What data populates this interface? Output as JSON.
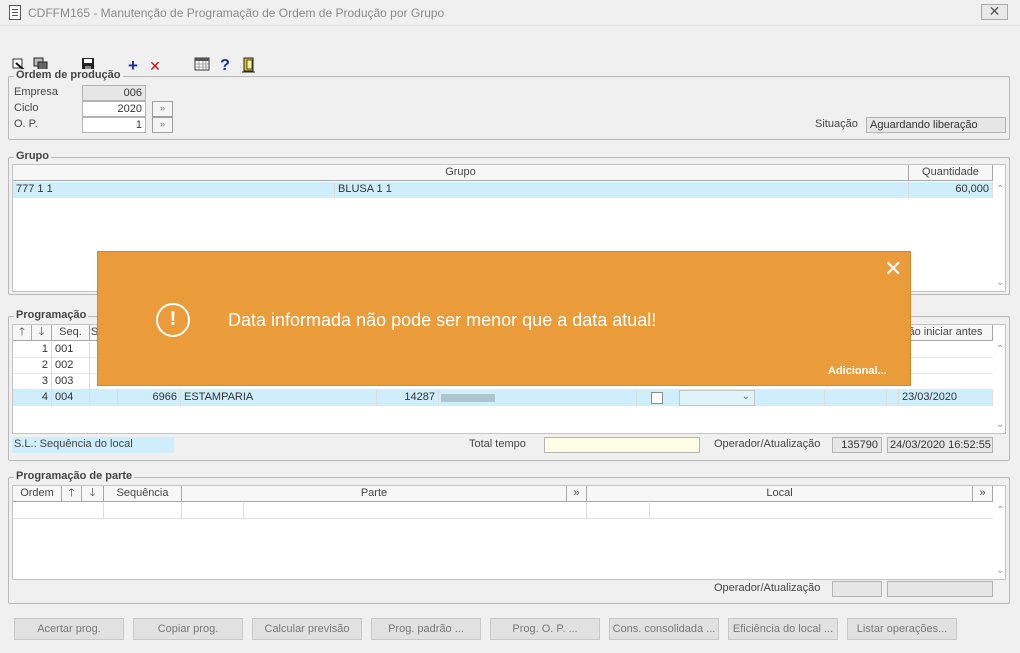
{
  "window": {
    "title": "CDFFM165 - Manutenção de Programação de Ordem de Produção por Grupo",
    "close_glyph": "✕"
  },
  "toolbar": {
    "icons": [
      "select-icon",
      "copy-icon",
      "save-icon",
      "add-icon",
      "delete-icon",
      "calendar-icon",
      "help-icon",
      "exit-icon"
    ],
    "add_glyph": "+",
    "delete_glyph": "✕",
    "help_glyph": "?"
  },
  "ordem": {
    "title": "Ordem de produção",
    "empresa_label": "Empresa",
    "empresa_value": "006",
    "ciclo_label": "Ciclo",
    "ciclo_value": "2020",
    "op_label": "O. P.",
    "op_value": "1",
    "situacao_label": "Situação",
    "situacao_value": "Aguardando liberação"
  },
  "grupo": {
    "title": "Grupo",
    "headers": {
      "grupo": "Grupo",
      "quantidade": "Quantidade"
    },
    "rows": [
      {
        "codigo": "777 1 1",
        "descricao": "BLUSA 1 1",
        "quantidade": "60,000"
      }
    ]
  },
  "programacao": {
    "title": "Programação",
    "headers": {
      "seq": "Seq.",
      "s": "S",
      "iniciar": "ão iniciar antes"
    },
    "rows": [
      {
        "n": "1",
        "seq": "001"
      },
      {
        "n": "2",
        "seq": "002"
      },
      {
        "n": "3",
        "seq": "003"
      },
      {
        "n": "4",
        "seq": "004",
        "local": "6966",
        "nome": "ESTAMPARIA",
        "cod": "14287",
        "data": "23/03/2020"
      }
    ],
    "sl_label": "S.L.: Sequência do local",
    "total_label": "Total tempo",
    "total_value": "",
    "operador_label": "Operador/Atualização",
    "operador_value": "135790",
    "atualizacao_value": "24/03/2020 16:52:55"
  },
  "parte": {
    "title": "Programação de parte",
    "headers": {
      "ordem": "Ordem",
      "sequencia": "Sequência",
      "parte": "Parte",
      "local": "Local"
    },
    "operador_label": "Operador/Atualização"
  },
  "buttons": [
    {
      "label": "Acertar prog."
    },
    {
      "label": "Copiar prog."
    },
    {
      "label": "Calcular previsão"
    },
    {
      "label": "Prog. padrão ..."
    },
    {
      "label": "Prog. O. P. ..."
    },
    {
      "label": "Cons. consolidada ..."
    },
    {
      "label": "Eficiência do local ..."
    },
    {
      "label": "Listar operações..."
    }
  ],
  "toast": {
    "message": "Data informada não pode ser menor que a data atual!",
    "more": "Adicional...",
    "icon_glyph": "!",
    "close_glyph": "✕"
  },
  "colors": {
    "toast_bg": "#ea9b3a",
    "selected_row": "#cdeefa",
    "total_field": "#fffde6"
  }
}
